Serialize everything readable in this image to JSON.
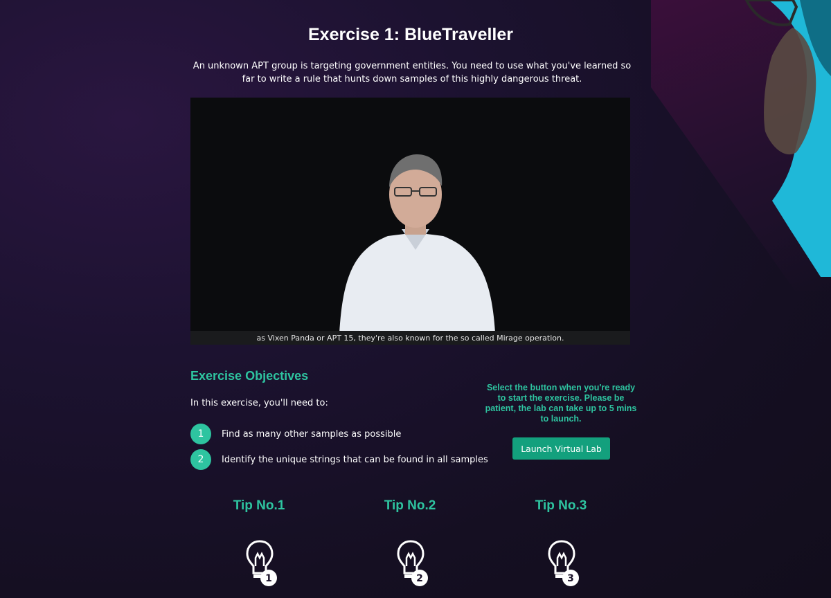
{
  "page": {
    "title": "Exercise 1: BlueTraveller",
    "intro": "An unknown APT group is targeting government entities. You need to use what you've learned so far to write a rule that hunts down samples of this highly dangerous threat."
  },
  "video": {
    "caption": "as Vixen Panda or APT 15, they're also known for the so called Mirage operation."
  },
  "objectives": {
    "heading": "Exercise Objectives",
    "lead": "In this exercise, you'll need to:",
    "items": [
      {
        "number": "1",
        "text": "Find as many other samples as possible"
      },
      {
        "number": "2",
        "text": "Identify the unique strings that can be found in all samples"
      }
    ]
  },
  "launch": {
    "note": "Select the button when you're ready to start the exercise. Please be patient, the lab can take up to 5 mins to launch.",
    "button_label": "Launch Virtual Lab"
  },
  "tips": [
    {
      "title": "Tip No.1",
      "badge": "1",
      "icon": "lightbulb-icon"
    },
    {
      "title": "Tip No.2",
      "badge": "2",
      "icon": "lightbulb-icon"
    },
    {
      "title": "Tip No.3",
      "badge": "3",
      "icon": "lightbulb-icon"
    }
  ],
  "colors": {
    "accent": "#2ec4a0",
    "button": "#13a07d",
    "background": "#1a1129"
  }
}
